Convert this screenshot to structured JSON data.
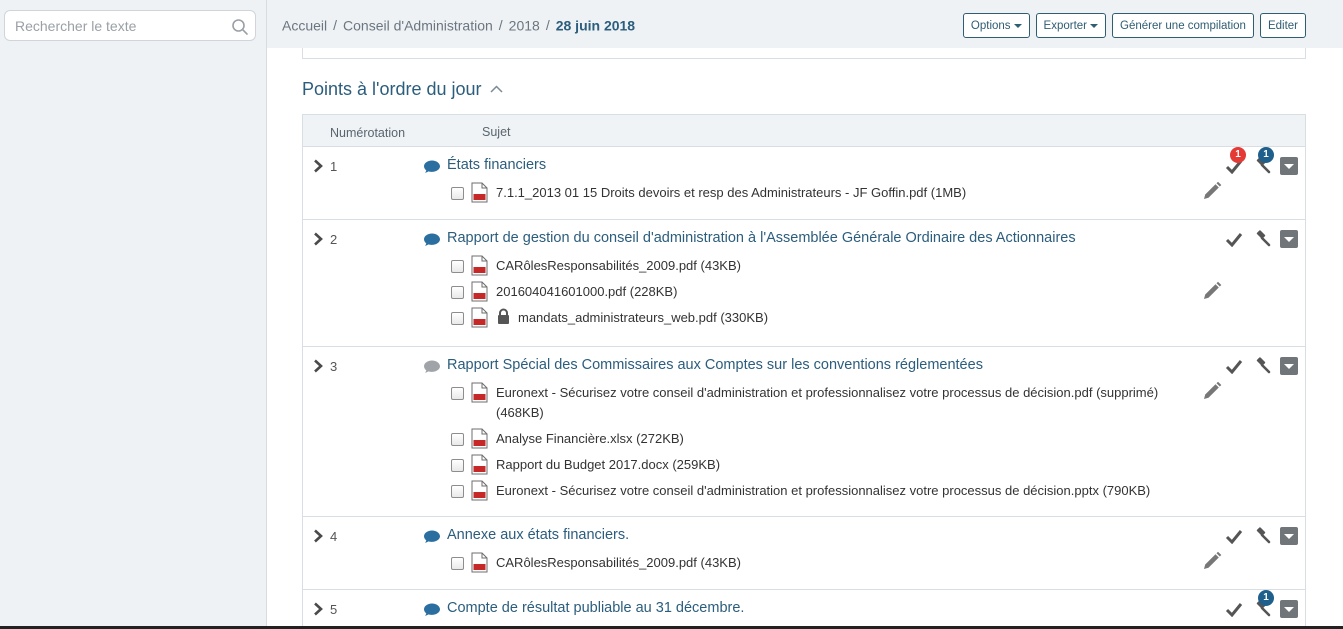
{
  "search": {
    "placeholder": "Rechercher le texte"
  },
  "breadcrumb": {
    "items": [
      "Accueil",
      "Conseil d'Administration",
      "2018"
    ],
    "current": "28 juin 2018",
    "separator": "/"
  },
  "toolbar": {
    "options": "Options",
    "export": "Exporter",
    "compile": "Générer une compilation",
    "edit": "Editer"
  },
  "section": {
    "title": "Points à l'ordre du jour"
  },
  "table": {
    "col_number": "Numérotation",
    "col_subject": "Sujet"
  },
  "rows": [
    {
      "num": "1",
      "title": "États financiers",
      "check_badge": "1",
      "hammer_badge": "1",
      "docs": [
        {
          "name": "7.1.1_2013 01 15 Droits devoirs et resp des Administrateurs - JF Goffin.pdf (1MB)"
        }
      ]
    },
    {
      "num": "2",
      "title": "Rapport de gestion du conseil d'administration à l'Assemblée Générale Ordinaire des Actionnaires",
      "docs": [
        {
          "name": "CARôlesResponsabilités_2009.pdf (43KB)"
        },
        {
          "name": "201604041601000.pdf (228KB)"
        },
        {
          "name": "mandats_administrateurs_web.pdf (330KB)"
        }
      ]
    },
    {
      "num": "3",
      "title": "Rapport Spécial des Commissaires aux Comptes sur les conventions réglementées",
      "docs": [
        {
          "name": "Euronext - Sécurisez votre conseil d'administration et professionnalisez votre processus de décision.pdf (supprimé) (468KB)"
        },
        {
          "name": "Analyse Financière.xlsx (272KB)"
        },
        {
          "name": "Rapport du Budget 2017.docx (259KB)"
        },
        {
          "name": "Euronext - Sécurisez votre conseil d'administration et professionnalisez votre processus de décision.pptx (790KB)"
        }
      ]
    },
    {
      "num": "4",
      "title": "Annexe aux états financiers.",
      "docs": [
        {
          "name": "CARôlesResponsabilités_2009.pdf (43KB)"
        }
      ]
    },
    {
      "num": "5",
      "title": "Compte de résultat publiable au 31 décembre.",
      "hammer_badge": "1",
      "docs": []
    }
  ],
  "colors": {
    "accent": "#2b5d7d",
    "sidebar_bg": "#eef2f5",
    "badge_red": "#e53935",
    "badge_blue": "#1f5f8b",
    "icon_gray": "#6f7579"
  },
  "icons": {
    "search": "search-icon",
    "expand": "chevron-right-icon",
    "agenda": "speech-bubble-icon",
    "file": "file-icon",
    "lock": "lock-icon",
    "check": "check-icon",
    "hammer": "gavel-icon",
    "dropdown": "dropdown-icon",
    "edit": "pencil-icon",
    "collapse": "chevron-up-icon"
  }
}
